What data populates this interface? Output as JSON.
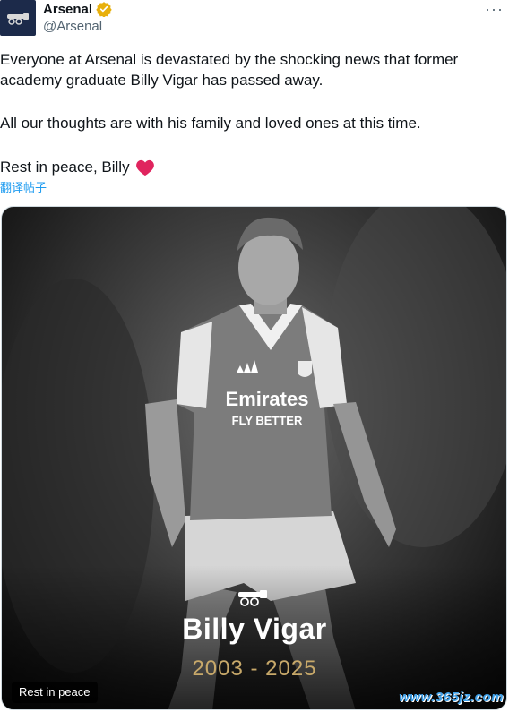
{
  "account": {
    "display_name": "Arsenal",
    "handle": "@Arsenal",
    "verified_icon": "verified-badge-icon",
    "avatar_icon": "arsenal-cannon-logo"
  },
  "more_label": "···",
  "tweet": {
    "paragraph1": "Everyone at Arsenal is devastated by the shocking news that former academy graduate Billy Vigar has passed away.",
    "paragraph2": "All our thoughts are with his family and loved ones at this time.",
    "paragraph3": "Rest in peace, Billy",
    "emoji": "red-heart-icon",
    "translate": "翻译帖子"
  },
  "media": {
    "name": "Billy Vigar",
    "years": "2003 - 2025",
    "alt_label": "Rest in peace",
    "sponsor_line1": "Emirates",
    "sponsor_line2": "FLY BETTER",
    "crest_icon": "arsenal-cannon-icon"
  },
  "watermark": "www.365jz.com",
  "colors": {
    "link": "#1d9bf0",
    "heart": "#e0245e",
    "years_gold": "#c8a96a"
  }
}
